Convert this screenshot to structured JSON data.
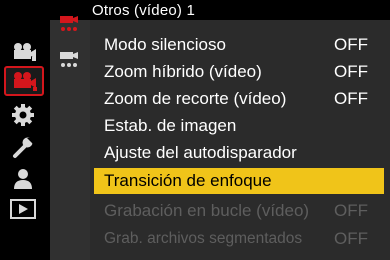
{
  "header": {
    "title": "Otros (vídeo) 1"
  },
  "tabs": [
    {
      "icon": "camera-settings-icon",
      "active": false
    },
    {
      "icon": "video-camera-icon",
      "active": true
    },
    {
      "icon": "gear-icon",
      "active": false
    },
    {
      "icon": "wrench-icon",
      "active": false
    },
    {
      "icon": "person-icon",
      "active": false
    },
    {
      "icon": "playback-icon",
      "active": false
    }
  ],
  "subtabs": [
    {
      "icon": "video-submenu-1-icon",
      "active": true
    },
    {
      "icon": "video-submenu-2-icon",
      "active": false
    }
  ],
  "menu": {
    "items": [
      {
        "label": "Modo silencioso",
        "value": "OFF",
        "state": "normal"
      },
      {
        "label": "Zoom híbrido (vídeo)",
        "value": "OFF",
        "state": "normal"
      },
      {
        "label": "Zoom de recorte (vídeo)",
        "value": "OFF",
        "state": "normal"
      },
      {
        "label": "Estab. de imagen",
        "value": "",
        "state": "normal"
      },
      {
        "label": "Ajuste del autodisparador",
        "value": "",
        "state": "normal"
      },
      {
        "label": "Transición de enfoque",
        "value": "",
        "state": "selected"
      },
      {
        "label": "Grabación en bucle (vídeo)",
        "value": "OFF",
        "state": "disabled"
      },
      {
        "label": "Grab. archivos segmentados",
        "value": "OFF",
        "state": "disabled"
      }
    ]
  },
  "colors": {
    "accent_red": "#d4161c",
    "highlight_yellow": "#f0c419",
    "panel_bg": "#2b2b2b",
    "disabled_text": "#5e5e5e"
  }
}
